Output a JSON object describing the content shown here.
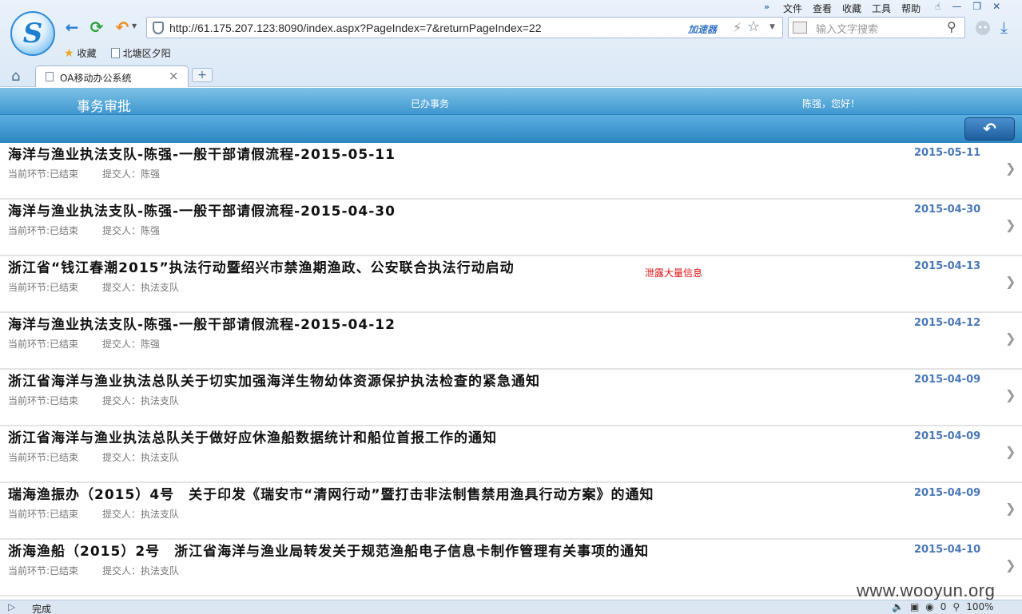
{
  "browser": {
    "url": "http://61.175.207.123:8090/index.aspx?PageIndex=7&returnPageIndex=22",
    "accelerator_label": "加速器",
    "search_placeholder": "输入文字搜索",
    "menu": [
      "文件",
      "查看",
      "收藏",
      "工具",
      "帮助"
    ],
    "menu_more": "»",
    "favorites": [
      "收藏",
      "北塘区夕阳"
    ],
    "tab_label": "OA移动办公系统",
    "status_text": "完成",
    "status_count": "0",
    "zoom": "100%"
  },
  "header": {
    "title": "事务审批",
    "section": "已办事务",
    "greeting": "陈强，您好！"
  },
  "items": [
    {
      "title": "海洋与渔业执法支队-陈强-一般干部请假流程-2015-05-11",
      "stage": "当前环节:已结束",
      "submitter": "提交人：陈强",
      "date": "2015-05-11",
      "flag": ""
    },
    {
      "title": "海洋与渔业执法支队-陈强-一般干部请假流程-2015-04-30",
      "stage": "当前环节:已结束",
      "submitter": "提交人：陈强",
      "date": "2015-04-30",
      "flag": ""
    },
    {
      "title": "浙江省“钱江春潮2015”执法行动暨绍兴市禁渔期渔政、公安联合执法行动启动",
      "stage": "当前环节:已结束",
      "submitter": "提交人：执法支队",
      "date": "2015-04-13",
      "flag": "泄露大量信息"
    },
    {
      "title": "海洋与渔业执法支队-陈强-一般干部请假流程-2015-04-12",
      "stage": "当前环节:已结束",
      "submitter": "提交人：陈强",
      "date": "2015-04-12",
      "flag": ""
    },
    {
      "title": "浙江省海洋与渔业执法总队关于切实加强海洋生物幼体资源保护执法检查的紧急通知",
      "stage": "当前环节:已结束",
      "submitter": "提交人：执法支队",
      "date": "2015-04-09",
      "flag": ""
    },
    {
      "title": "浙江省海洋与渔业执法总队关于做好应休渔船数据统计和船位首报工作的通知",
      "stage": "当前环节:已结束",
      "submitter": "提交人：执法支队",
      "date": "2015-04-09",
      "flag": ""
    },
    {
      "title": "瑞海渔振办（2015）4号　关于印发《瑞安市“清网行动”暨打击非法制售禁用渔具行动方案》的通知",
      "stage": "当前环节:已结束",
      "submitter": "提交人：执法支队",
      "date": "2015-04-09",
      "flag": ""
    },
    {
      "title": "浙海渔船（2015）2号　浙江省海洋与渔业局转发关于规范渔船电子信息卡制作管理有关事项的通知",
      "stage": "当前环节:已结束",
      "submitter": "提交人：执法支队",
      "date": "2015-04-10",
      "flag": ""
    }
  ],
  "watermark": "www.wooyun.org"
}
